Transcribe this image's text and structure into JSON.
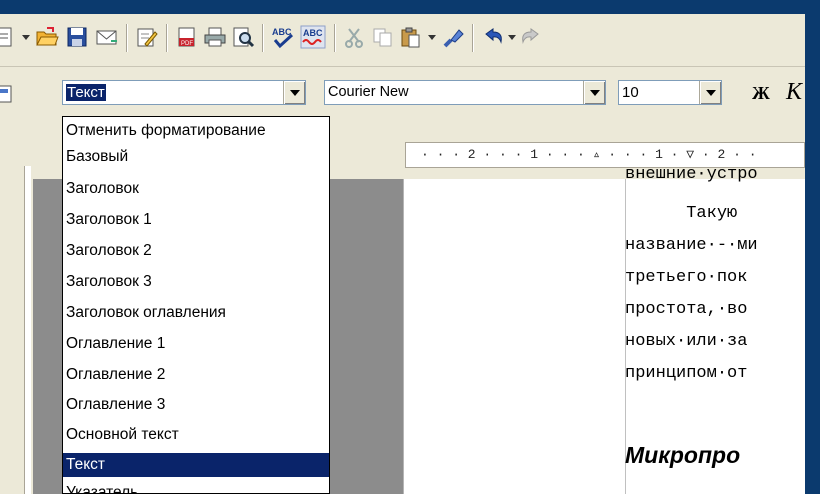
{
  "formatting": {
    "style_value": "Текст",
    "font_value": "Courier New",
    "size_value": "10",
    "bold_label": "Ж",
    "italic_label": "К"
  },
  "style_list": [
    "Отменить форматирование",
    "Базовый",
    "Заголовок",
    "Заголовок 1",
    "Заголовок 2",
    "Заголовок 3",
    "Заголовок оглавления",
    "Оглавление 1",
    "Оглавление 2",
    "Оглавление 3",
    "Основной текст",
    "Текст",
    "Указатель"
  ],
  "selected_style": "Текст",
  "ruler": {
    "marks": "· · · 2 · · · 1 · · · ▵ · · · 1 · ▽ · 2 · ·"
  },
  "document": {
    "lines": [
      "внешние·устро",
      "      Такую",
      "название·-·ми",
      "третьего·пок",
      "простота,·во",
      "новых·или·за",
      "принципом·от"
    ],
    "heading": "Микропро"
  },
  "colors": {
    "background": "#0b3a6e",
    "selection": "#0a246a"
  }
}
